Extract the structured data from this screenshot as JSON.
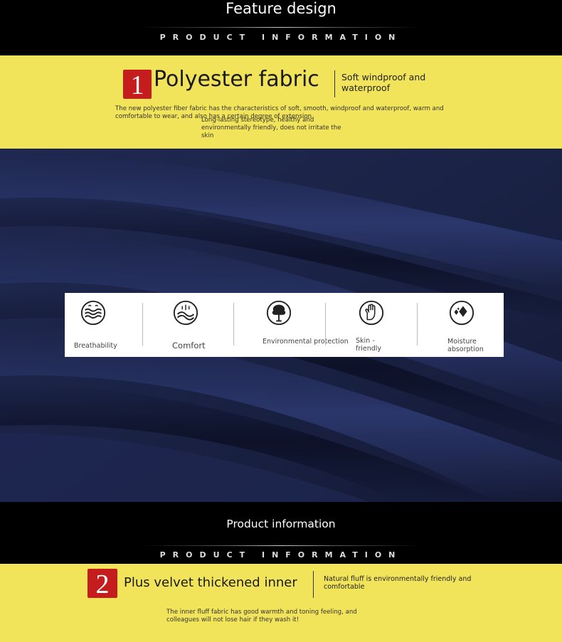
{
  "header1": {
    "title": "Feature design",
    "subtitle": "PRODUCT INFORMATION"
  },
  "section1": {
    "number": "1",
    "title": "Polyester fabric",
    "side_note": "Soft windproof and waterproof",
    "description": "The new polyester fiber fabric has the characteristics of soft, smooth, windproof and waterproof, warm and comfortable to wear, and also has a certain degree of extension",
    "description2": "Long-lasting stereotype, healthy and environmentally friendly, does not irritate the skin"
  },
  "features": [
    {
      "label": "Breathability",
      "icon": "breathability-icon"
    },
    {
      "label": "Comfort",
      "icon": "comfort-icon"
    },
    {
      "label": "Environmental protection",
      "icon": "tree-icon"
    },
    {
      "label": "Skin -friendly",
      "icon": "hand-icon"
    },
    {
      "label": "Moisture absorption",
      "icon": "droplets-icon"
    }
  ],
  "header2": {
    "title": "Product information",
    "subtitle": "PRODUCT INFORMATION"
  },
  "section2": {
    "number": "2",
    "title": "Plus velvet thickened inner",
    "side_note": "Natural fluff is environmentally friendly and comfortable",
    "description": "The inner fluff fabric has good warmth and toning feeling, and colleagues will not lose hair if they wash it!"
  },
  "colors": {
    "band": "#f2e45a",
    "number_box": "#c51d1d",
    "fabric": "#1c2446",
    "header": "#000000"
  }
}
